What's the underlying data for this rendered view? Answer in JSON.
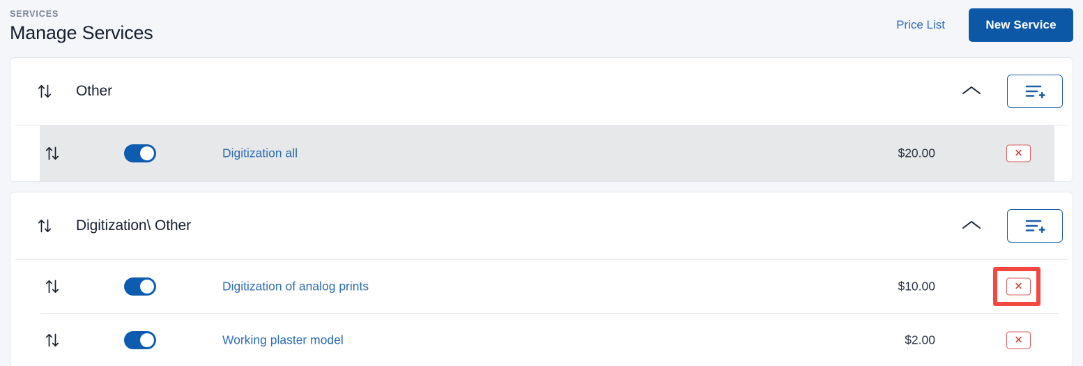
{
  "header": {
    "eyebrow": "SERVICES",
    "title": "Manage Services",
    "price_list_label": "Price List",
    "new_service_label": "New Service"
  },
  "icons": {
    "sort": "sort-updown-icon",
    "collapse": "chevron-up-icon",
    "add_list_item": "list-add-icon",
    "delete": "close-x-icon"
  },
  "colors": {
    "accent": "#0d58a6",
    "link": "#2d6cb5",
    "toggle_on": "#0d5cb0",
    "delete_border": "#d45c5c",
    "delete_glyph": "#d0342c",
    "annotation": "#f4473f",
    "page_bg": "#f4f6fa",
    "row_highlight": "#e7e8e9"
  },
  "sections": [
    {
      "title": "Other",
      "expanded": true,
      "rows": [
        {
          "name": "Digitization all",
          "price": "$20.00",
          "enabled": true,
          "highlighted": true,
          "annotated": false
        }
      ]
    },
    {
      "title": "Digitization\\ Other",
      "expanded": true,
      "rows": [
        {
          "name": "Digitization of analog prints",
          "price": "$10.00",
          "enabled": true,
          "highlighted": false,
          "annotated": true
        },
        {
          "name": "Working plaster model",
          "price": "$2.00",
          "enabled": true,
          "highlighted": false,
          "annotated": false
        }
      ]
    }
  ]
}
